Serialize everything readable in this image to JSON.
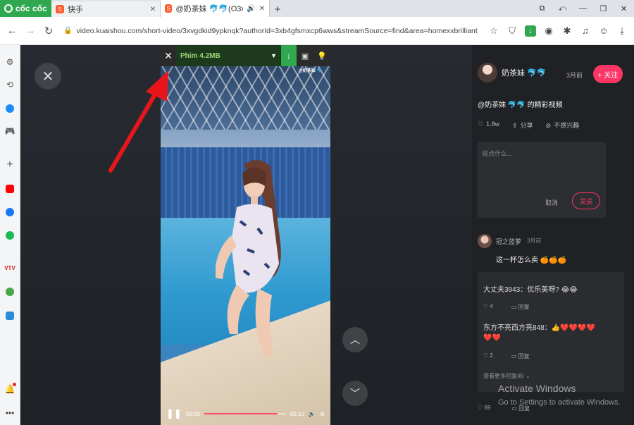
{
  "browser": {
    "brand": "cốc cốc",
    "tabs": [
      {
        "label": "快手",
        "active": false
      },
      {
        "label": "@奶茶妹 🐬🐬(O3xb4g",
        "active": true
      }
    ],
    "new_tab_label": "+",
    "url": "video.kuaishou.com/short-video/3xvgdkid9ypknqk?authorId=3xb4gfsmxcp6wws&streamSource=find&area=homexxbrilliant"
  },
  "downloader": {
    "label": "Phim 4.2MB",
    "watermark": "@奶茶妹 🐬"
  },
  "video": {
    "current_time": "00:09",
    "duration": "00:10",
    "progress": 0.9
  },
  "panel": {
    "author": "奶茶妹 🐬🐬",
    "date": "3月前",
    "follow_label": "+ 关注",
    "description": "@奶茶妹 🐬🐬 的精彩视频",
    "likes": "1.8w",
    "share_label": "分享",
    "dislike_label": "不感兴趣",
    "comment_placeholder": "说点什么...",
    "cancel_label": "取消",
    "send_label": "发送",
    "comment1": {
      "user": "冠之蓝萝",
      "date": "3月前",
      "text": "这一杯怎么卖 🍊🍊🍊"
    },
    "reply1": {
      "text": "大丈夫3943：优乐美呀? 😂😂",
      "likes": "4",
      "reply_label": "回复"
    },
    "reply2": {
      "text1": "东方不亮西方亮848：👍❤️❤️❤️❤️",
      "text2": "❤️❤️",
      "likes": "2",
      "reply_label": "回复"
    },
    "more_replies": "查看更多回复(8) ⌄",
    "bottom_likes": "69",
    "bottom_reply": "回复"
  },
  "windows_notice": {
    "title": "Activate Windows",
    "subtitle": "Go to Settings to activate Windows."
  },
  "colors": {
    "accent": "#fe3666",
    "coccoc_green": "#2fa84f",
    "panel_bg": "#1f2124"
  }
}
